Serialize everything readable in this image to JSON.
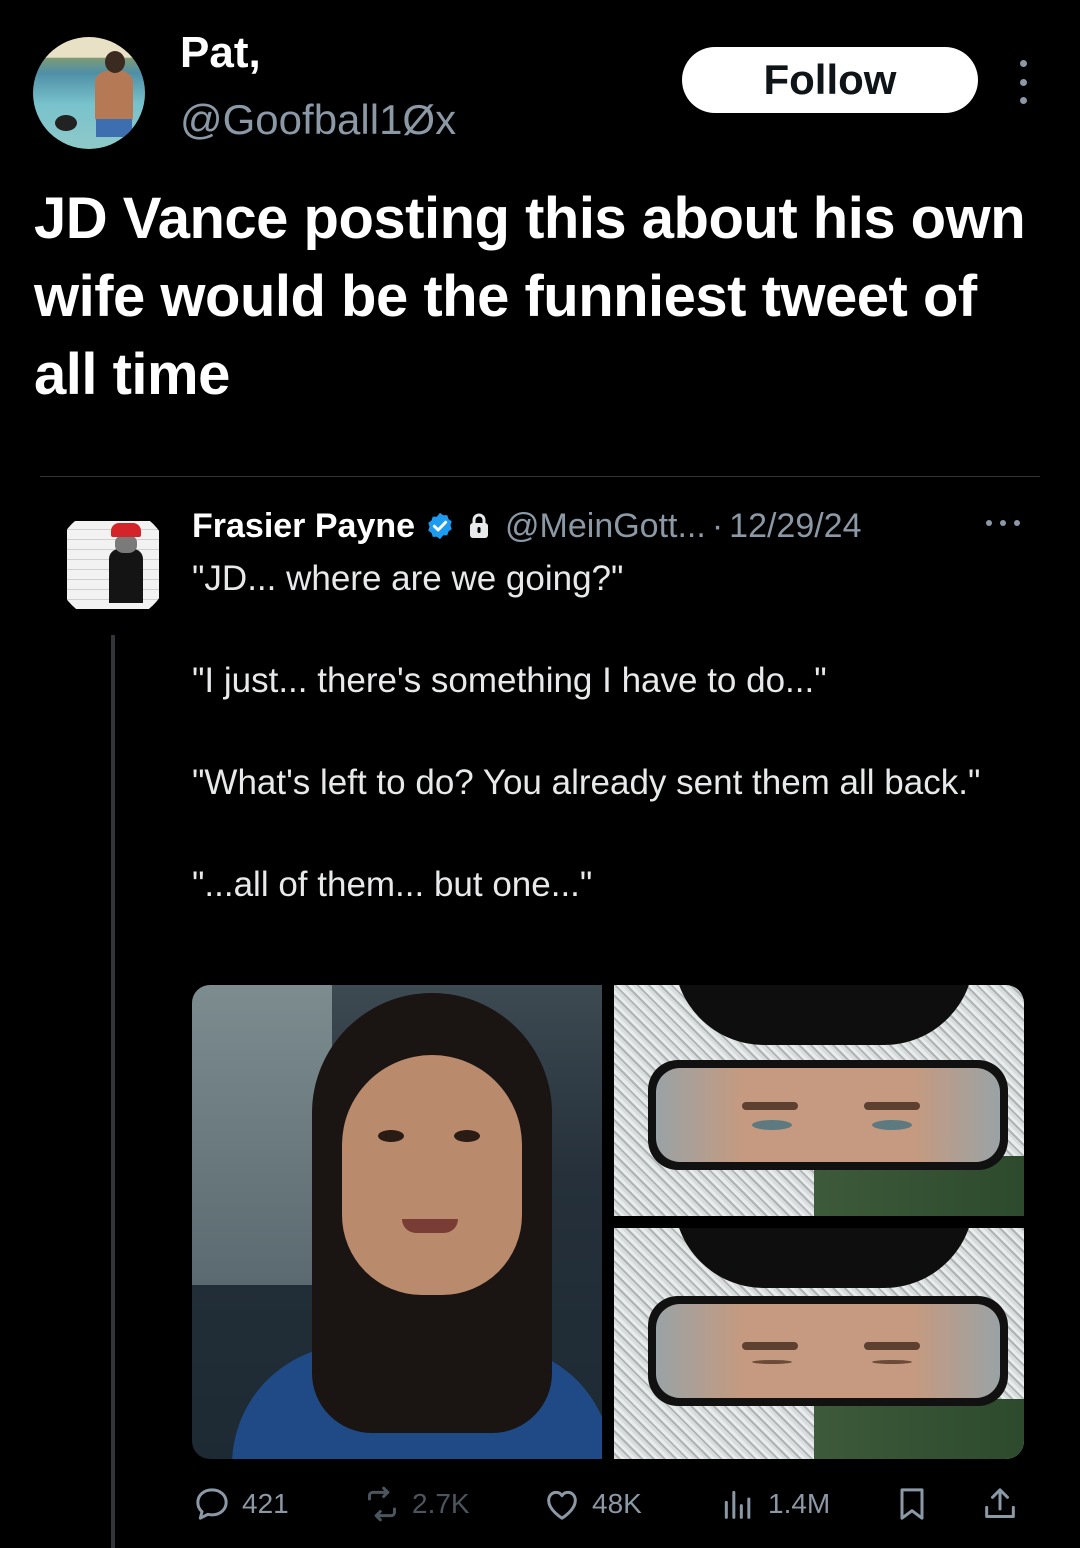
{
  "author": {
    "display_name": "Pat,",
    "handle": "@Goofball1Øx",
    "follow_label": "Follow"
  },
  "tweet": {
    "text": "JD Vance posting this about his own wife would be the funniest tweet of all time"
  },
  "reply": {
    "name": "Frasier Payne",
    "handle": "@MeinGott...",
    "dot": "·",
    "date": "12/29/24",
    "paragraphs": [
      "\"JD... where are we going?\"",
      "\"I just... there's something I have to do...\"",
      "\"What's left to do? You already sent them all back.\"",
      "\"...all of them... but one...\""
    ],
    "actions": {
      "replies": "421",
      "reposts": "2.7K",
      "likes": "48K",
      "views": "1.4M"
    }
  },
  "colors": {
    "background": "#000000",
    "text_primary": "#e7e9ea",
    "text_secondary": "#8b98a5",
    "verified_blue": "#1d9bf0",
    "divider": "#2f3336"
  },
  "icons": {
    "more_vertical": "more-vertical-icon",
    "verified": "verified-badge-icon",
    "lock": "lock-icon",
    "more_horizontal": "more-horizontal-icon",
    "reply": "reply-icon",
    "repost": "repost-icon",
    "like": "heart-icon",
    "views": "views-icon",
    "bookmark": "bookmark-icon",
    "share": "share-icon"
  }
}
